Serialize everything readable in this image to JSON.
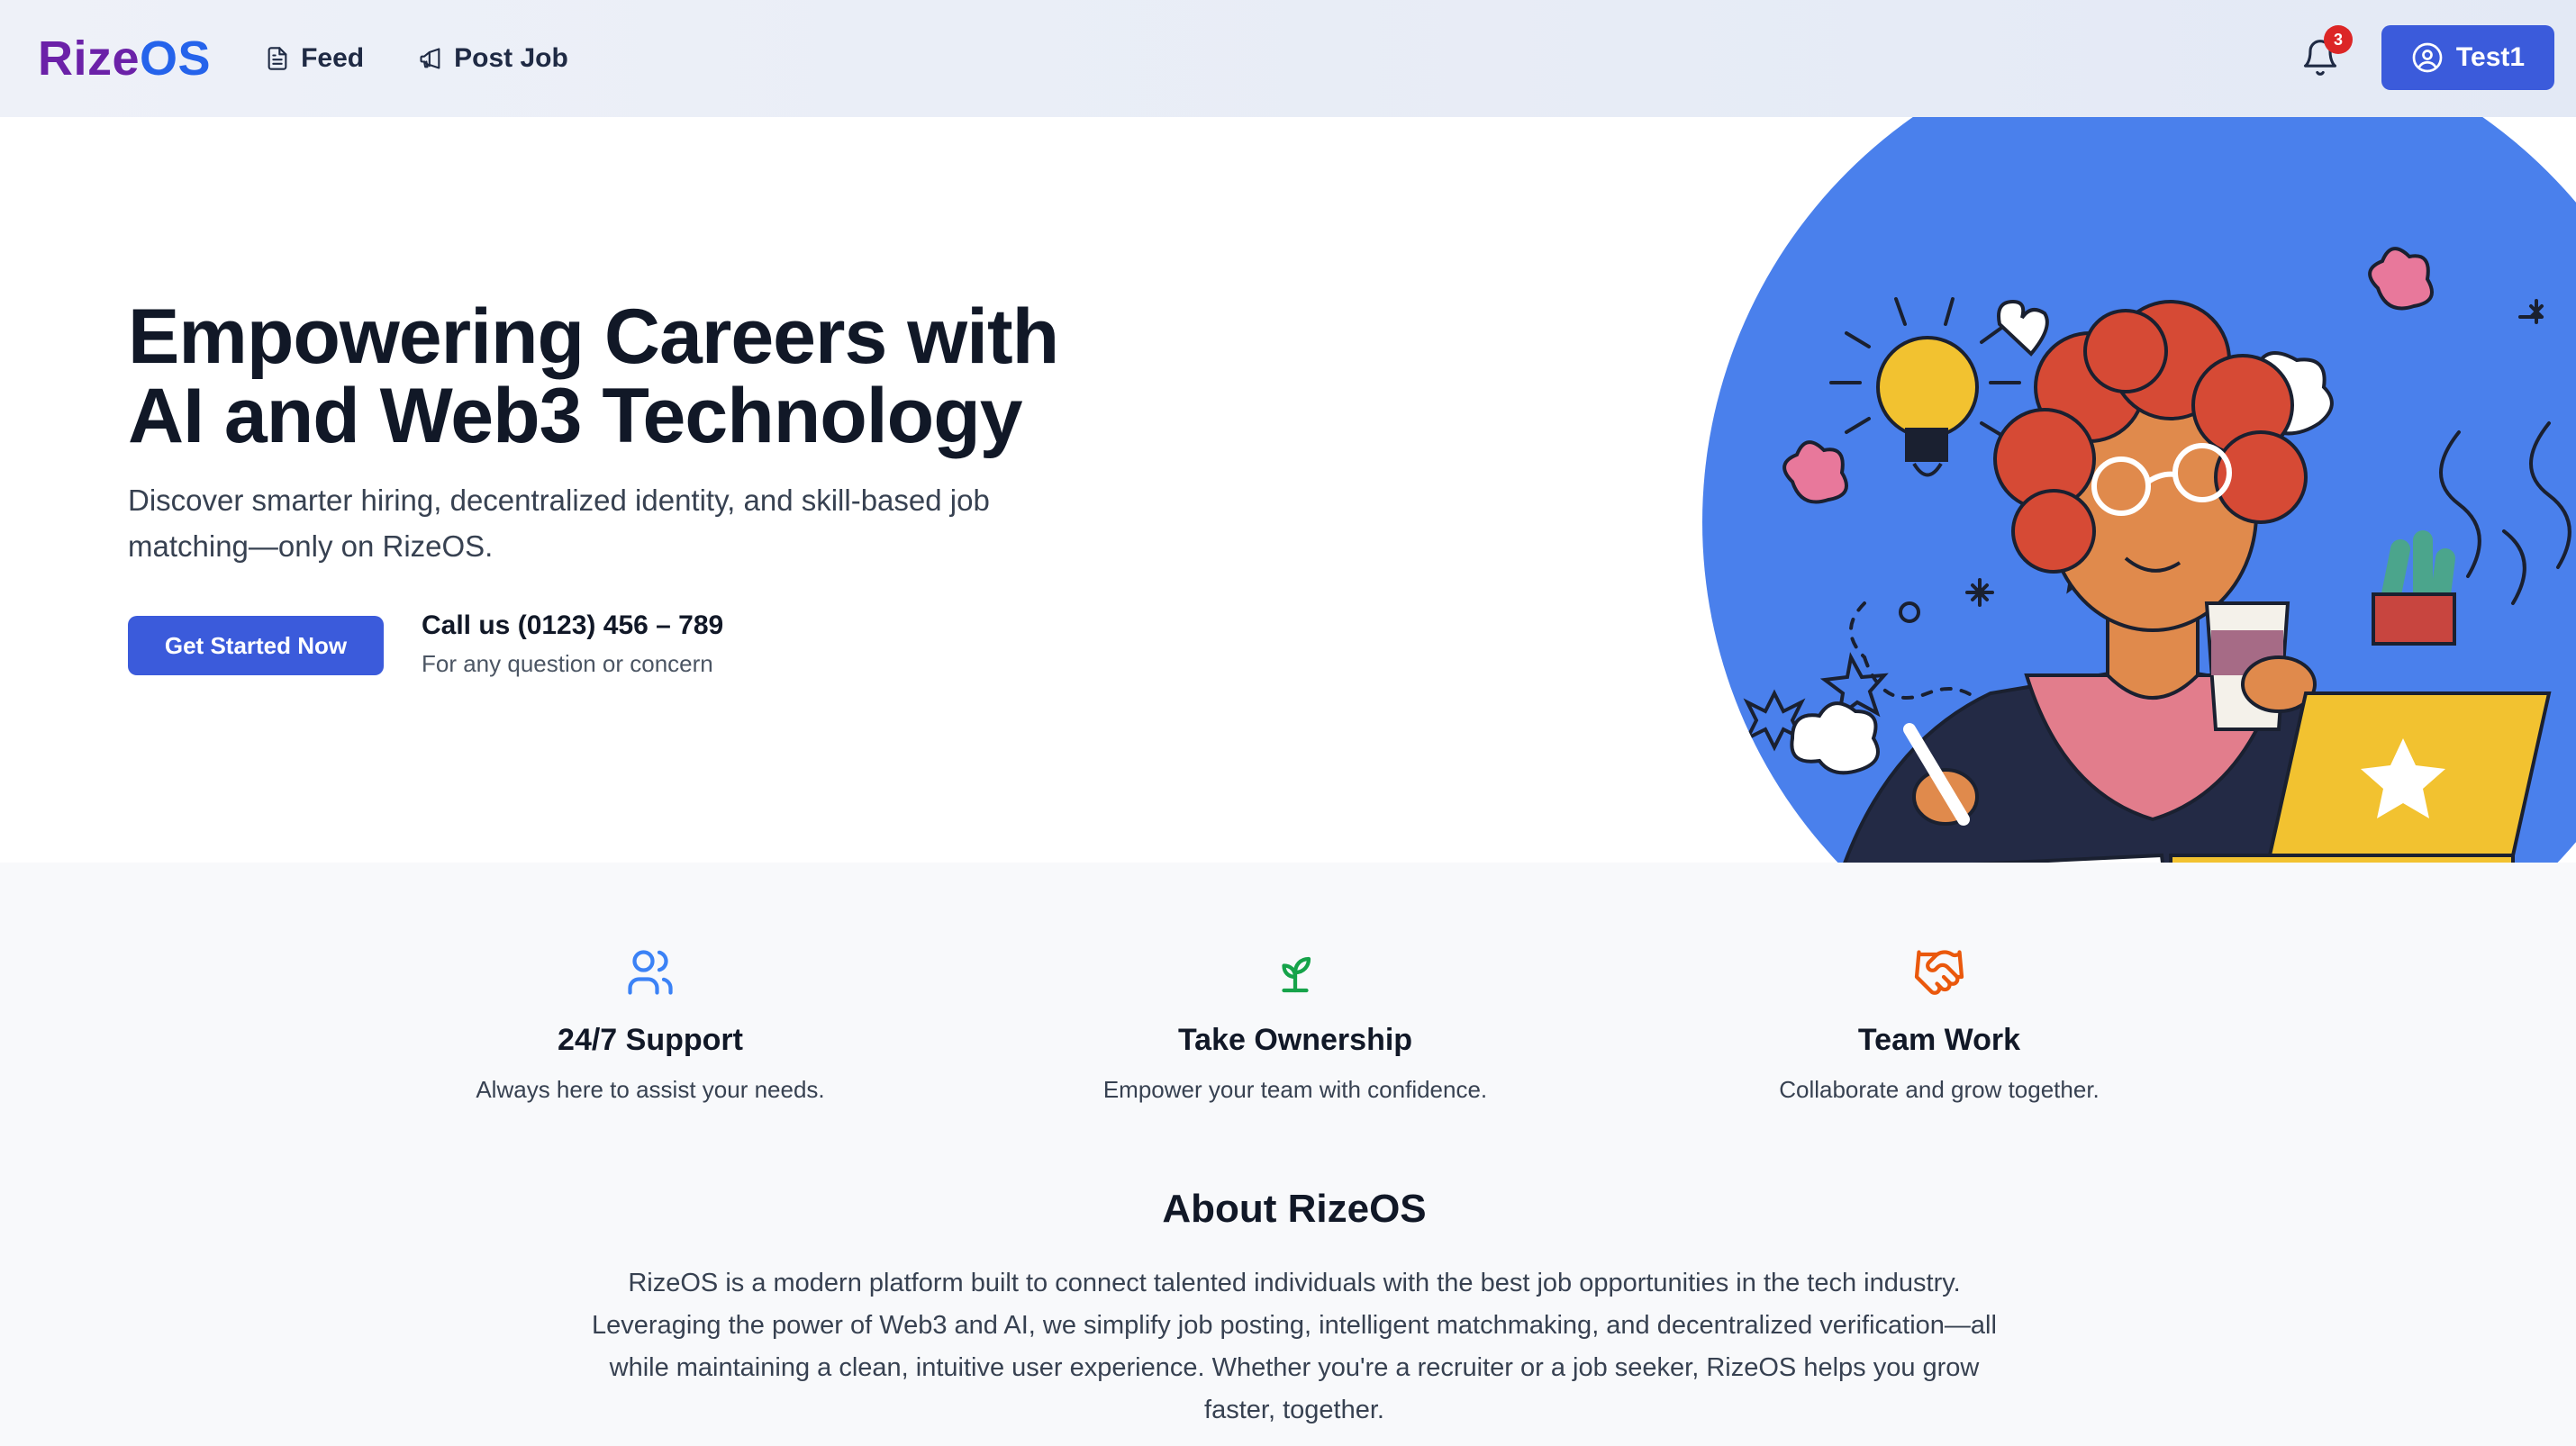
{
  "nav": {
    "logo_part1": "Rize",
    "logo_part2": "OS",
    "links": [
      {
        "label": "Feed",
        "icon": "document-icon"
      },
      {
        "label": "Post Job",
        "icon": "megaphone-icon"
      }
    ],
    "notification_count": "3",
    "user_label": "Test1"
  },
  "hero": {
    "title_line1": "Empowering Careers with",
    "title_line2": "AI and Web3 Technology",
    "subtitle": "Discover smarter hiring, decentralized identity, and skill-based job matching—only on RizeOS.",
    "cta_label": "Get Started Now",
    "call_title": "Call us (0123) 456 – 789",
    "call_sub": "For any question or concern"
  },
  "features": [
    {
      "title": "24/7 Support",
      "desc": "Always here to assist your needs.",
      "icon": "users-icon",
      "color": "#3b82f6"
    },
    {
      "title": "Take Ownership",
      "desc": "Empower your team with confidence.",
      "icon": "sprout-icon",
      "color": "#16a34a"
    },
    {
      "title": "Team Work",
      "desc": "Collaborate and grow together.",
      "icon": "handshake-icon",
      "color": "#ea580c"
    }
  ],
  "about": {
    "title": "About RizeOS",
    "text": "RizeOS is a modern platform built to connect talented individuals with the best job opportunities in the tech industry. Leveraging the power of Web3 and AI, we simplify job posting, intelligent matchmaking, and decentralized verification—all while maintaining a clean, intuitive user experience. Whether you're a recruiter or a job seeker, RizeOS helps you grow faster, together."
  },
  "colors": {
    "accent": "#3b5bdb",
    "hero_circle": "#4a80ec",
    "badge": "#dc2626"
  }
}
